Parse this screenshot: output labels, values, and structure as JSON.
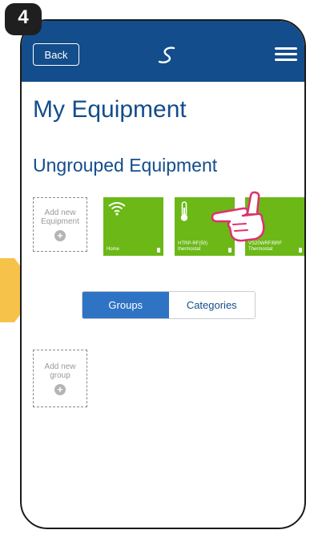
{
  "step": {
    "number": "4"
  },
  "header": {
    "back_label": "Back",
    "logo_icon": "salus-logo-icon",
    "menu_icon": "hamburger-menu-icon"
  },
  "page": {
    "title": "My Equipment",
    "section_title": "Ungrouped Equipment"
  },
  "add_equipment": {
    "line1": "Add new",
    "line2": "Equipment",
    "plus": "+"
  },
  "devices": [
    {
      "label": "Home",
      "icon": "wifi-icon"
    },
    {
      "label": "HTRP-RF(50) thermostat",
      "icon": "thermometer-icon"
    },
    {
      "label": "VS20WRF/BRF Thermostat",
      "icon": "none"
    }
  ],
  "segments": {
    "groups": "Groups",
    "categories": "Categories",
    "active": "groups"
  },
  "add_group": {
    "line1": "Add new",
    "line2": "group",
    "plus": "+"
  },
  "colors": {
    "header": "#134d8b",
    "tile": "#6bb817",
    "accent": "#2f73c4",
    "highlight_hand": "#e0306f",
    "arrow": "#f6c24a"
  }
}
